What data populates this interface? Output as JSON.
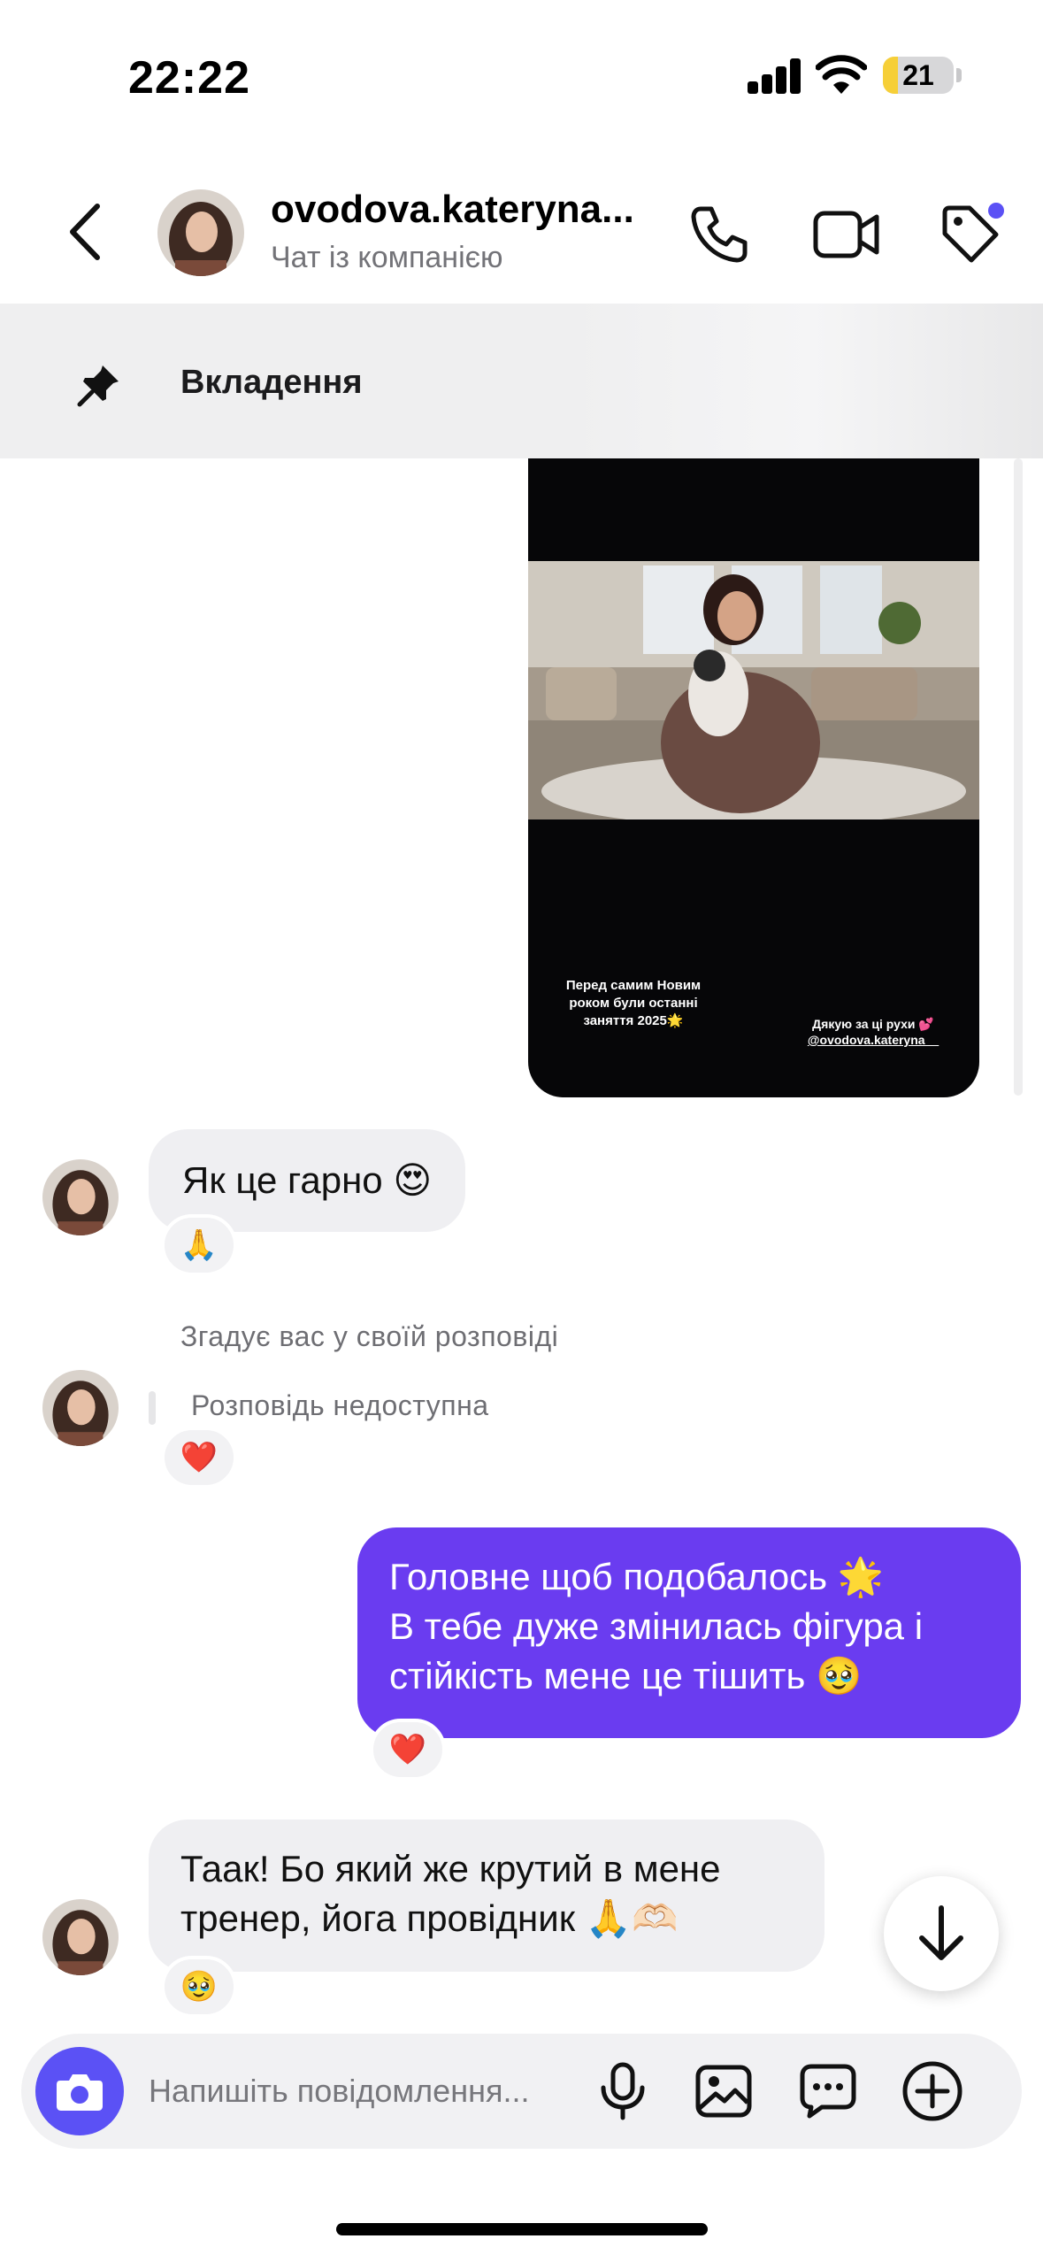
{
  "status_bar": {
    "time": "22:22",
    "battery": "21",
    "battery_level": 0.21
  },
  "header": {
    "contact_name": "ovodova.kateryna...",
    "subtitle": "Чат із компанією",
    "icons": [
      "back-chevron-icon",
      "phone-icon",
      "video-icon",
      "tag-icon"
    ]
  },
  "pinned": {
    "label": "Вкладення",
    "icon": "pin-icon"
  },
  "story": {
    "caption_left": "Перед самим Новим роком були останні заняття 2025🌟",
    "caption_right_line1": "Дякую за ці рухи 💕",
    "caption_right_handle": "@ovodova.kateryna__"
  },
  "messages": {
    "m1": {
      "text": "Як це гарно 😍",
      "reaction": "🙏"
    },
    "mention_note": "Згадує вас у своїй розповіді",
    "story_unavailable": "Розповідь недоступна",
    "m2_reaction": "❤️",
    "m3": {
      "line1": "Головне щоб подобалось 🌟",
      "line2": "В тебе дуже змінилась фігура і",
      "line3": "стійкість мене це тішить 🥹",
      "reaction": "❤️"
    },
    "m4": {
      "line1": "Таак! Бо який же крутий в мене",
      "line2": "тренер, йога провідник 🙏🫶🏻",
      "reaction": "🥹"
    }
  },
  "composer": {
    "placeholder": "Напишіть повідомлення...",
    "icons": [
      "camera-icon",
      "microphone-icon",
      "image-icon",
      "sticker-icon",
      "plus-icon"
    ]
  },
  "colors": {
    "accent": "#5b51f5",
    "outgoing_bubble": "#6a3cf0",
    "incoming_bubble": "#efeff2"
  }
}
